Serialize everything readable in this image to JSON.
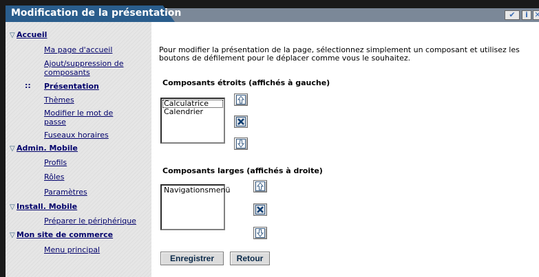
{
  "header": {
    "title": "Modification de la présentation",
    "icons": [
      "check-icon",
      "info-icon",
      "close-icon"
    ]
  },
  "sidebar": {
    "sections": [
      {
        "label": "Accueil",
        "items": [
          {
            "label": "Ma page d'accueil"
          },
          {
            "label": "Ajout/suppression de composants"
          },
          {
            "label": "Présentation",
            "active": true
          },
          {
            "label": "Thèmes"
          },
          {
            "label": "Modifier le mot de passe"
          },
          {
            "label": "Fuseaux horaires"
          }
        ]
      },
      {
        "label": "Admin. Mobile",
        "items": [
          {
            "label": "Profils"
          },
          {
            "label": "Rôles"
          },
          {
            "label": "Paramètres"
          }
        ]
      },
      {
        "label": "Install. Mobile",
        "items": [
          {
            "label": "Préparer le périphérique"
          }
        ]
      },
      {
        "label": "Mon site de commerce",
        "items": [
          {
            "label": "Menu principal"
          }
        ]
      }
    ]
  },
  "content": {
    "instructions": "Pour modifier la présentation de la page, sélectionnez simplement un composant et utilisez les boutons de défilement pour le déplacer comme vous le souhaitez.",
    "narrow": {
      "heading": "Composants étroits (affichés à gauche)",
      "options": [
        "Calculatrice",
        "Calendrier"
      ]
    },
    "wide": {
      "heading": "Composants larges (affichés à droite)",
      "options": [
        "Navigationsmenü"
      ]
    },
    "buttons": {
      "save": "Enregistrer",
      "back": "Retour"
    }
  },
  "colors": {
    "title_tab": "#2a5d8c",
    "title_bar": "#7b8898",
    "link": "#00006b",
    "button_text": "#0b2a4a"
  }
}
